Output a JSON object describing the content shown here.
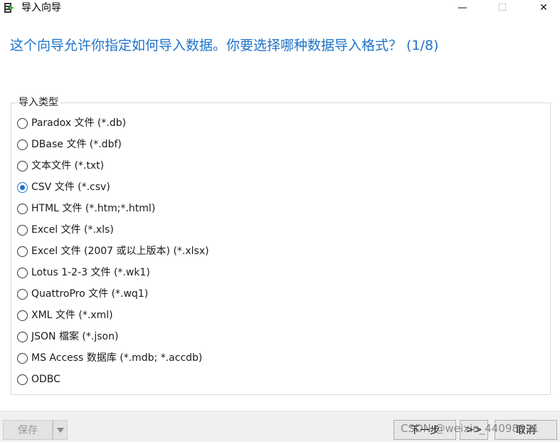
{
  "window": {
    "title": "导入向导",
    "minimize_glyph": "—",
    "maximize_glyph": "☐",
    "close_glyph": "✕"
  },
  "header": {
    "question": "这个向导允许你指定如何导入数据。你要选择哪种数据导入格式？ (1/8)"
  },
  "import_type": {
    "label": "导入类型",
    "selected_index": 3,
    "options": [
      "Paradox 文件 (*.db)",
      "DBase 文件 (*.dbf)",
      "文本文件 (*.txt)",
      "CSV 文件 (*.csv)",
      "HTML 文件 (*.htm;*.html)",
      "Excel 文件 (*.xls)",
      "Excel 文件 (2007 或以上版本) (*.xlsx)",
      "Lotus 1-2-3 文件 (*.wk1)",
      "QuattroPro 文件 (*.wq1)",
      "XML 文件 (*.xml)",
      "JSON 檔案 (*.json)",
      "MS Access 数据库 (*.mdb; *.accdb)",
      "ODBC"
    ]
  },
  "footer": {
    "save_label": "保存",
    "next_label": "下一步",
    "skip_label": ">>",
    "cancel_label": "取消"
  },
  "watermark": "CSDN @weixin_44098921",
  "colors": {
    "accent": "#1e73c8",
    "footer_bg": "#f0f0f0"
  }
}
